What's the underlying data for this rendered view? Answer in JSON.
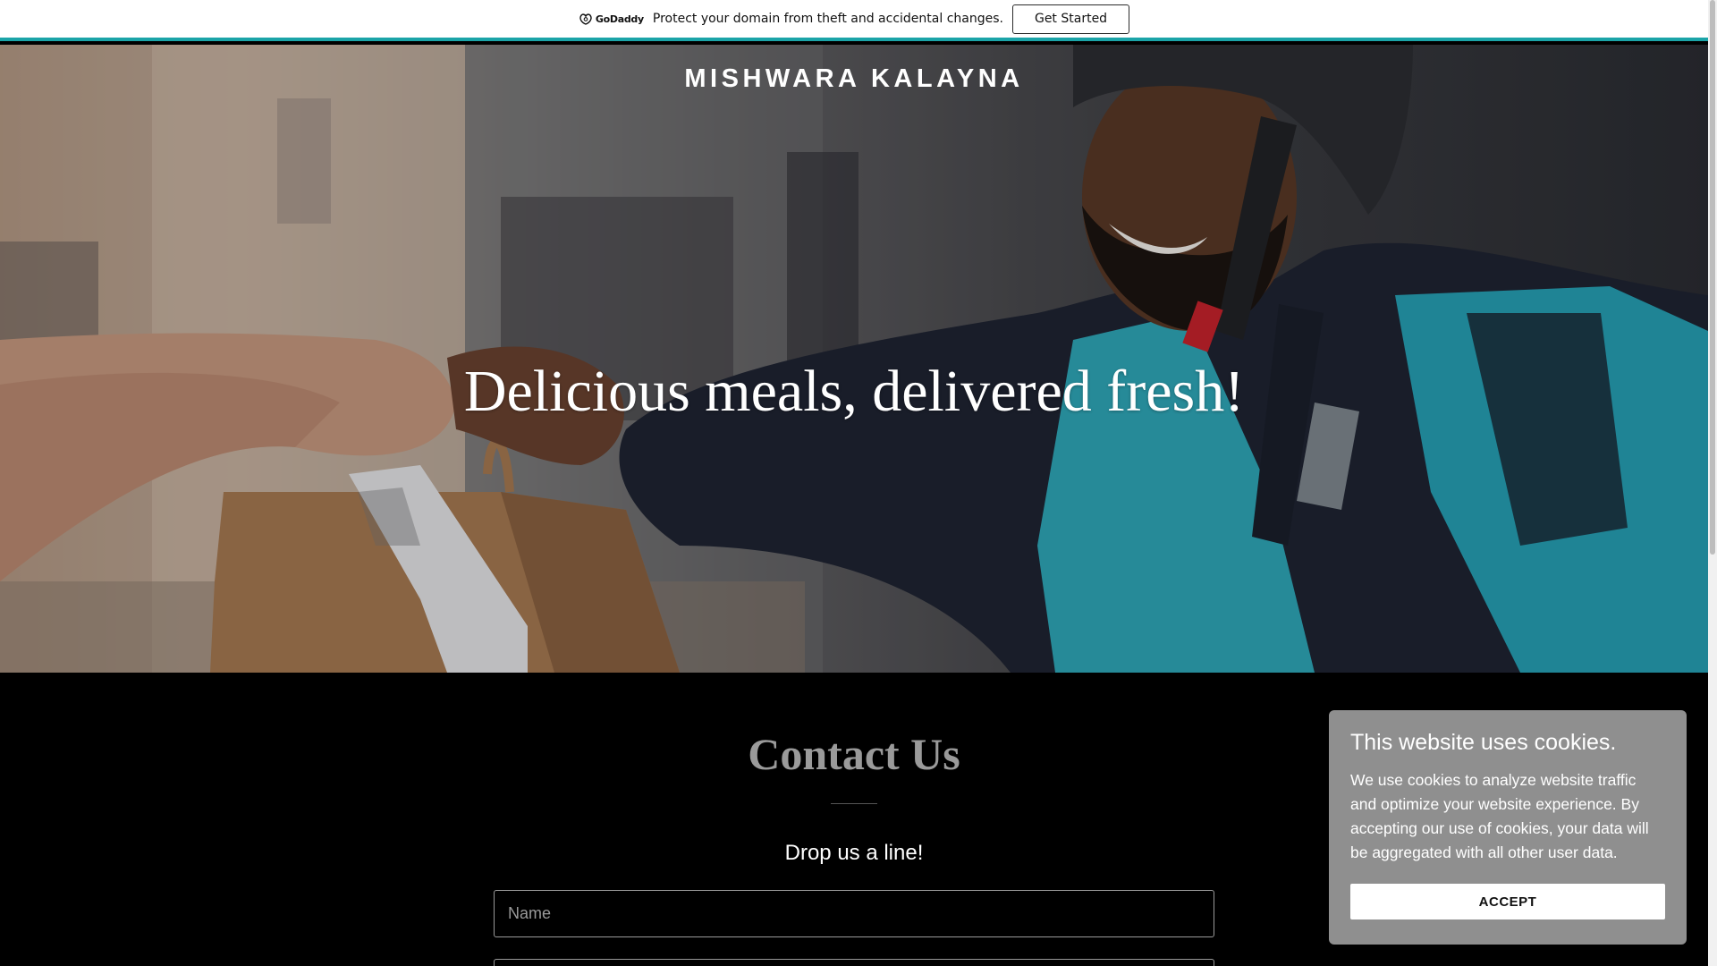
{
  "promo": {
    "logo_text": "GoDaddy",
    "message": "Protect your domain from theft and accidental changes.",
    "button": "Get Started"
  },
  "hero": {
    "site_name": "MISHWARA KALAYNA",
    "headline": "Delicious meals, delivered fresh!"
  },
  "contact": {
    "title": "Contact Us",
    "subtitle": "Drop us a line!",
    "name_placeholder": "Name",
    "email_placeholder": ""
  },
  "cookie": {
    "title": "This website uses cookies.",
    "body": "We use cookies to analyze website traffic and optimize your website experience. By accepting our use of cookies, your data will be aggregated with all other user data.",
    "button": "ACCEPT"
  },
  "colors": {
    "accent_teal": "#1ba4a8",
    "background": "#000000",
    "cookie_bg": "#8f8f8f"
  }
}
